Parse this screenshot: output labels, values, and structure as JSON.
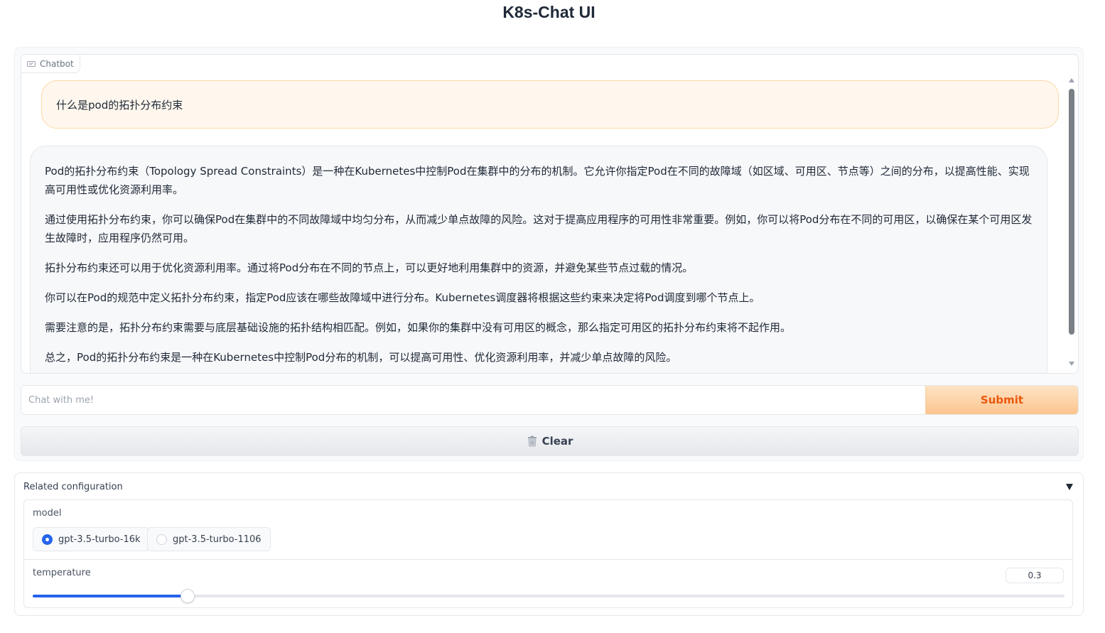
{
  "app": {
    "title": "K8s-Chat UI"
  },
  "chatbot": {
    "label": "Chatbot",
    "messages": [
      {
        "role": "user",
        "text": "什么是pod的拓扑分布约束"
      },
      {
        "role": "bot",
        "paragraphs": [
          "Pod的拓扑分布约束（Topology Spread Constraints）是一种在Kubernetes中控制Pod在集群中的分布的机制。它允许你指定Pod在不同的故障域（如区域、可用区、节点等）之间的分布，以提高性能、实现高可用性或优化资源利用率。",
          "通过使用拓扑分布约束，你可以确保Pod在集群中的不同故障域中均匀分布，从而减少单点故障的风险。这对于提高应用程序的可用性非常重要。例如，你可以将Pod分布在不同的可用区，以确保在某个可用区发生故障时，应用程序仍然可用。",
          "拓扑分布约束还可以用于优化资源利用率。通过将Pod分布在不同的节点上，可以更好地利用集群中的资源，并避免某些节点过载的情况。",
          "你可以在Pod的规范中定义拓扑分布约束，指定Pod应该在哪些故障域中进行分布。Kubernetes调度器将根据这些约束来决定将Pod调度到哪个节点上。",
          "需要注意的是，拓扑分布约束需要与底层基础设施的拓扑结构相匹配。例如，如果你的集群中没有可用区的概念，那么指定可用区的拓扑分布约束将不起作用。",
          "总之，Pod的拓扑分布约束是一种在Kubernetes中控制Pod分布的机制，可以提高可用性、优化资源利用率，并减少单点故障的风险。"
        ]
      }
    ]
  },
  "input": {
    "placeholder": "Chat with me!",
    "value": ""
  },
  "buttons": {
    "submit": "Submit",
    "clear": "Clear"
  },
  "config": {
    "title": "Related configuration",
    "model": {
      "label": "model",
      "options": [
        "gpt-3.5-turbo-16k",
        "gpt-3.5-turbo-1106"
      ],
      "selected": "gpt-3.5-turbo-16k"
    },
    "temperature": {
      "label": "temperature",
      "value": "0.3",
      "fraction": 0.15
    }
  },
  "colors": {
    "accent": "#2563eb",
    "submit_text": "#ea580c",
    "user_bubble": "#fff7ed"
  },
  "icons": [
    "chat-bubble-icon",
    "trash-icon",
    "caret-down-icon",
    "scroll-up-icon",
    "scroll-down-icon"
  ]
}
